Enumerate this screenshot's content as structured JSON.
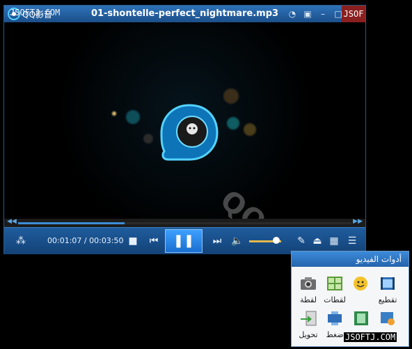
{
  "app": {
    "name": "QQ影音",
    "watermark_top_left": "JSOFTJ.COM",
    "track_title": "01-shontelle-perfect_nightmare.mp3",
    "watermark_top_right": "JSOF"
  },
  "titlebar_icons": [
    "chat-icon",
    "screen-icon",
    "minimize-icon",
    "maximize-icon"
  ],
  "video": {
    "watermark": "QQ-Player.com"
  },
  "seek": {
    "progress": 0.32
  },
  "controls": {
    "current_time": "00:01:07",
    "total_time": "00:03:50",
    "volume": 0.85
  },
  "tools_panel": {
    "title": "أدوات الفيديو",
    "items": [
      {
        "label": "تقطيع",
        "icon": "cut-icon"
      },
      {
        "label": "",
        "icon": "gif-icon"
      },
      {
        "label": "لقطات",
        "icon": "frames-icon"
      },
      {
        "label": "لقطة",
        "icon": "camera-icon"
      },
      {
        "label": "",
        "icon": "merge-icon"
      },
      {
        "label": "",
        "icon": "film-icon"
      },
      {
        "label": "ضغط",
        "icon": "compress-icon"
      },
      {
        "label": "تحويل",
        "icon": "convert-icon"
      }
    ]
  },
  "watermark_bottom": "JSOFTJ.COM"
}
